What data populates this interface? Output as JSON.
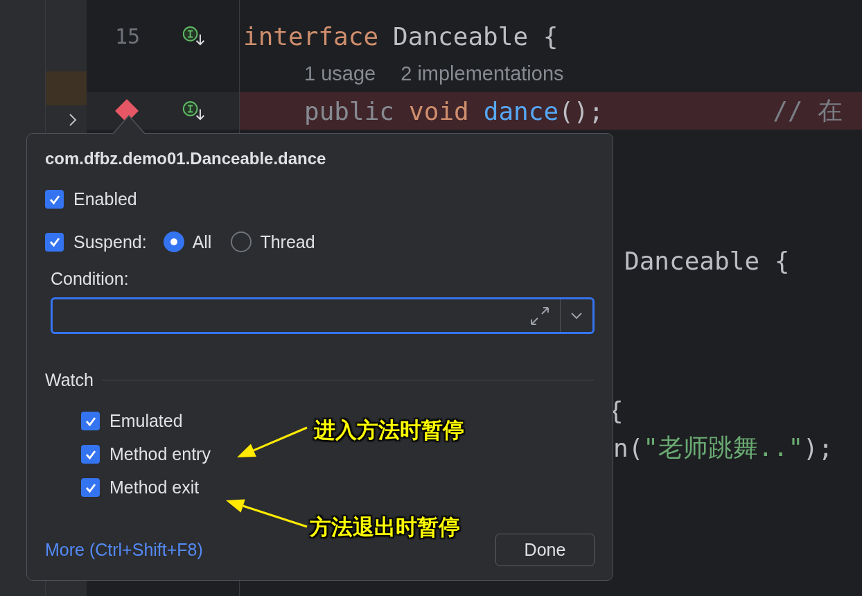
{
  "side_panel": {
    "items": [
      {
        "kind": "marker"
      },
      {
        "kind": "expander"
      }
    ]
  },
  "editor": {
    "rows": [
      {},
      {
        "line_number": "15",
        "icons": [
          {
            "kind": "interface"
          }
        ],
        "tokens": [
          {
            "kind": "keyword",
            "text": "interface"
          },
          {
            "kind": "plain",
            "text": "Danceable {"
          }
        ]
      },
      {
        "hints": [
          "1 usage",
          "2 implementations"
        ]
      },
      {
        "highlighted": true,
        "icons": [
          {
            "kind": "breakpoint"
          },
          {
            "kind": "interface"
          }
        ],
        "tokens": [
          {
            "kind": "redundant",
            "text": "public"
          },
          {
            "kind": "keyword",
            "text": "void"
          },
          {
            "kind": "method",
            "text": "dance"
          },
          {
            "kind": "plain",
            "text": "();"
          },
          {
            "kind": "comment",
            "text": "// 在"
          }
        ]
      },
      {},
      {},
      {},
      {
        "tokens": [
          {
            "kind": "plain",
            "text": "Danceable {"
          }
        ]
      },
      {},
      {},
      {},
      {
        "tokens": [
          {
            "kind": "plain",
            "text": "{"
          }
        ]
      },
      {
        "tokens": [
          {
            "kind": "plain",
            "text": "n("
          },
          {
            "kind": "string",
            "text": "\"老师跳舞..\""
          },
          {
            "kind": "plain",
            "text": ");"
          }
        ]
      },
      {},
      {},
      {},
      {}
    ]
  },
  "popup": {
    "title": "com.dfbz.demo01.Danceable.dance",
    "enabled": {
      "label": "Enabled",
      "checked": true
    },
    "suspend": {
      "label": "Suspend:",
      "checked": true,
      "options": [
        {
          "label": "All",
          "selected": true
        },
        {
          "label": "Thread",
          "selected": false
        }
      ]
    },
    "condition": {
      "label": "Condition:"
    },
    "watch": {
      "title": "Watch",
      "items": [
        {
          "label": "Emulated",
          "checked": true
        },
        {
          "label": "Method entry",
          "checked": true
        },
        {
          "label": "Method exit",
          "checked": true
        }
      ]
    },
    "more_link": "More (Ctrl+Shift+F8)",
    "done_button": "Done"
  },
  "annotations": [
    {
      "text": "进入方法时暂停"
    },
    {
      "text": "方法退出时暂停"
    }
  ]
}
